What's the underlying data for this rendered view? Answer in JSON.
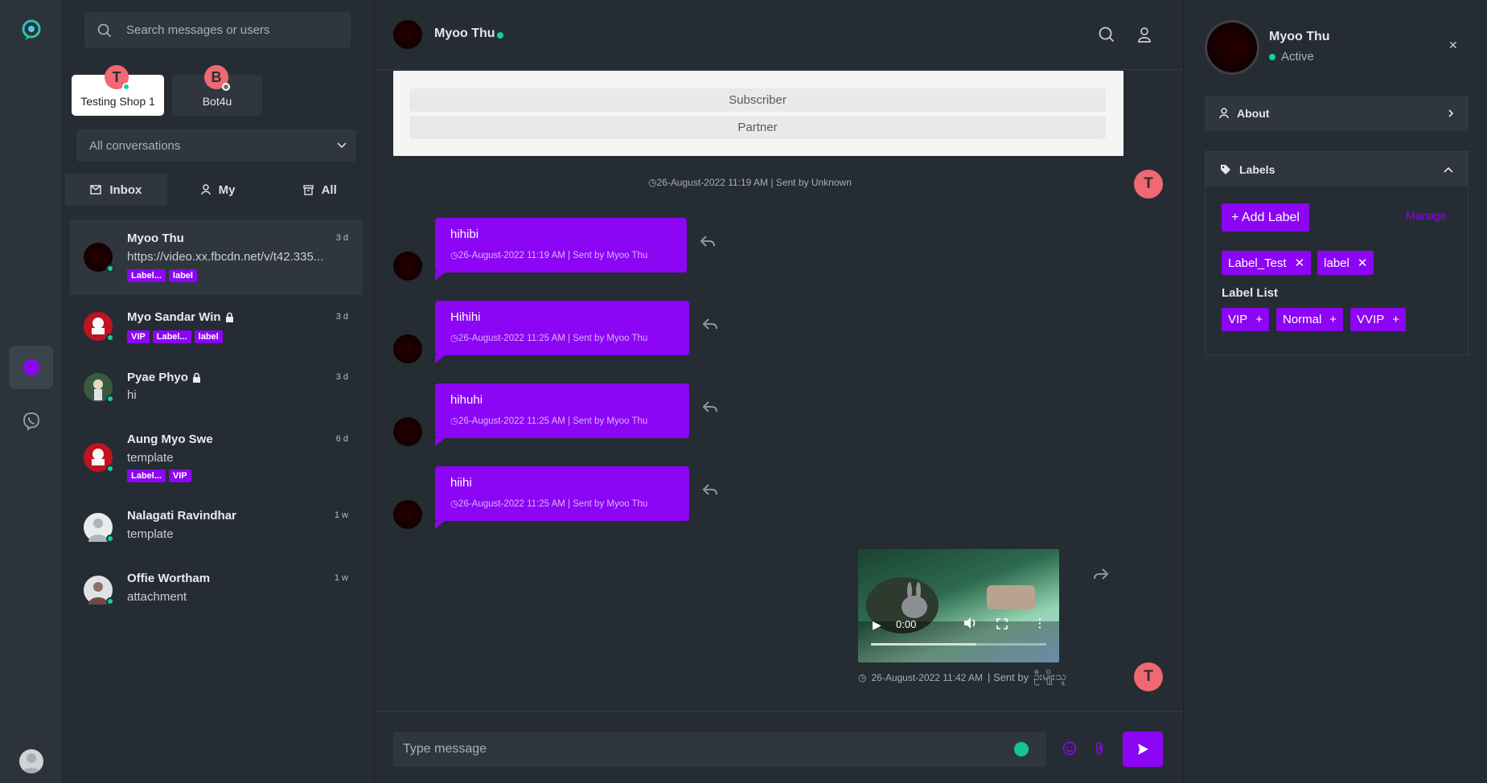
{
  "sidebar": {
    "search_placeholder": "Search messages or users",
    "inboxes": [
      {
        "initial": "T",
        "name": "Testing Shop 1"
      },
      {
        "initial": "B",
        "name": "Bot4u"
      }
    ],
    "filter": "All conversations",
    "tabs": [
      "Inbox",
      "My",
      "All"
    ],
    "conversations": [
      {
        "name": "Myoo Thu",
        "preview": "https://video.xx.fbcdn.net/v/t42.335...",
        "time": "3 d",
        "labels": [
          "Label...",
          "label"
        ]
      },
      {
        "name": "Myo Sandar Win",
        "preview": "",
        "time": "3 d",
        "labels": [
          "VIP",
          "Label...",
          "label"
        ]
      },
      {
        "name": "Pyae Phyo",
        "preview": "hi",
        "time": "3 d",
        "labels": []
      },
      {
        "name": "Aung Myo Swe",
        "preview": "template",
        "time": "6 d",
        "labels": [
          "Label...",
          "VIP"
        ]
      },
      {
        "name": "Nalagati Ravindhar",
        "preview": "template",
        "time": "1 w",
        "labels": []
      },
      {
        "name": "Offie Wortham",
        "preview": "attachment",
        "time": "1 w",
        "labels": []
      }
    ]
  },
  "chat": {
    "contact_name": "Myoo Thu",
    "card_buttons": [
      "Subscriber",
      "Partner"
    ],
    "card_meta": "26-August-2022 11:19 AM  |  Sent by Unknown",
    "agent_initial": "T",
    "messages": [
      {
        "text": "hihibi",
        "meta": "26-August-2022 11:19 AM  |  Sent by Myoo Thu"
      },
      {
        "text": "Hihihi",
        "meta": "26-August-2022 11:25 AM  |  Sent by Myoo Thu"
      },
      {
        "text": "hihuhi",
        "meta": "26-August-2022 11:25 AM  |  Sent by Myoo Thu"
      },
      {
        "text": "hiihi",
        "meta": "26-August-2022 11:25 AM  |  Sent by Myoo Thu"
      }
    ],
    "video": {
      "time": "0:00",
      "meta": "26-August-2022 11:42 AM",
      "sent_by": "|  Sent by",
      "sender_script": "ဦးမျိုးသူ"
    },
    "composer_placeholder": "Type message"
  },
  "profile": {
    "name": "Myoo Thu",
    "status": "Active",
    "about_label": "About",
    "labels_title": "Labels",
    "add_label": "+ Add Label",
    "manage": "Manage",
    "assigned_labels": [
      "Label_Test",
      "label"
    ],
    "label_list_title": "Label List",
    "label_list": [
      "VIP",
      "Normal",
      "VVIP"
    ]
  },
  "colors": {
    "accent": "#8c05f4",
    "online": "#06d6a0",
    "avatar": "#f06873",
    "bg": "#262c33",
    "surface": "#2f363d"
  }
}
